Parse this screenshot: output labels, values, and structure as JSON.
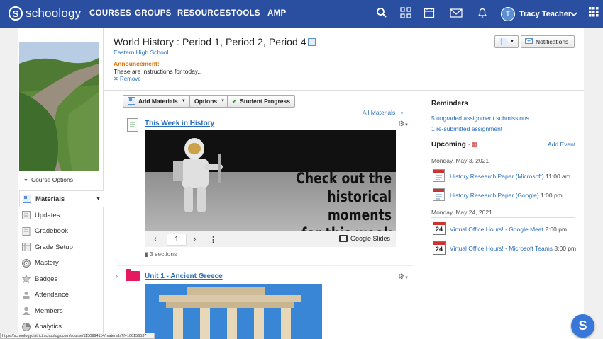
{
  "app": {
    "logo_text": "schoology",
    "logo_letter": "S"
  },
  "nav": {
    "items": [
      "COURSES",
      "GROUPS",
      "RESOURCES",
      "TOOLS",
      "AMP"
    ],
    "user_initial": "T",
    "user_name": "Tracy Teacher"
  },
  "course": {
    "title": "World History : Period 1, Period 2, Period 4",
    "school": "Eastern High School",
    "announcement_label": "Announcement:",
    "announcement_text": "These are instructions for today..",
    "remove_label": "Remove",
    "notifications_label": "Notifications",
    "course_options": "Course Options"
  },
  "sidebar": {
    "items": [
      {
        "label": "Materials",
        "icon": "materials-icon"
      },
      {
        "label": "Updates",
        "icon": "updates-icon"
      },
      {
        "label": "Gradebook",
        "icon": "gradebook-icon"
      },
      {
        "label": "Grade Setup",
        "icon": "grade-setup-icon"
      },
      {
        "label": "Mastery",
        "icon": "mastery-icon"
      },
      {
        "label": "Badges",
        "icon": "badges-icon"
      },
      {
        "label": "Attendance",
        "icon": "attendance-icon"
      },
      {
        "label": "Members",
        "icon": "members-icon"
      },
      {
        "label": "Analytics",
        "icon": "analytics-icon"
      }
    ]
  },
  "toolbar": {
    "add_materials": "Add Materials",
    "options": "Options",
    "student_progress": "Student Progress",
    "all_materials": "All Materials"
  },
  "materials": {
    "item1_title": "This Week in History",
    "headline_1": "Check out the",
    "headline_2": "historical moments",
    "headline_3": "for this week",
    "slide_page": "1",
    "google_slides": "Google Slides",
    "sections": "3 sections",
    "item2_title": "Unit 1 - Ancient Greece"
  },
  "reminders": {
    "heading": "Reminders",
    "links": [
      "5 ungraded assignment submissions",
      "1 re-submitted assignment"
    ]
  },
  "upcoming": {
    "heading": "Upcoming",
    "add_event": "Add Event",
    "cal_num": "24",
    "days": [
      {
        "date": "Monday, May 3, 2021",
        "events": [
          {
            "title": "History Research Paper (Microsoft)",
            "time": "11:00 am"
          },
          {
            "title": "History Research Paper (Google)",
            "time": "1:00 pm"
          }
        ]
      },
      {
        "date": "Monday, May 24, 2021",
        "events": [
          {
            "title": "Virtual Office Hours! - Google Meet",
            "time": "2:00 pm"
          },
          {
            "title": "Virtual Office Hours! - Microsoft Teams",
            "time": "3:00 pm"
          }
        ]
      }
    ]
  },
  "statusbar": "https://schoologydistrict.schoology.com/course/1130994114/materials?f=106156537",
  "fab_letter": "S"
}
